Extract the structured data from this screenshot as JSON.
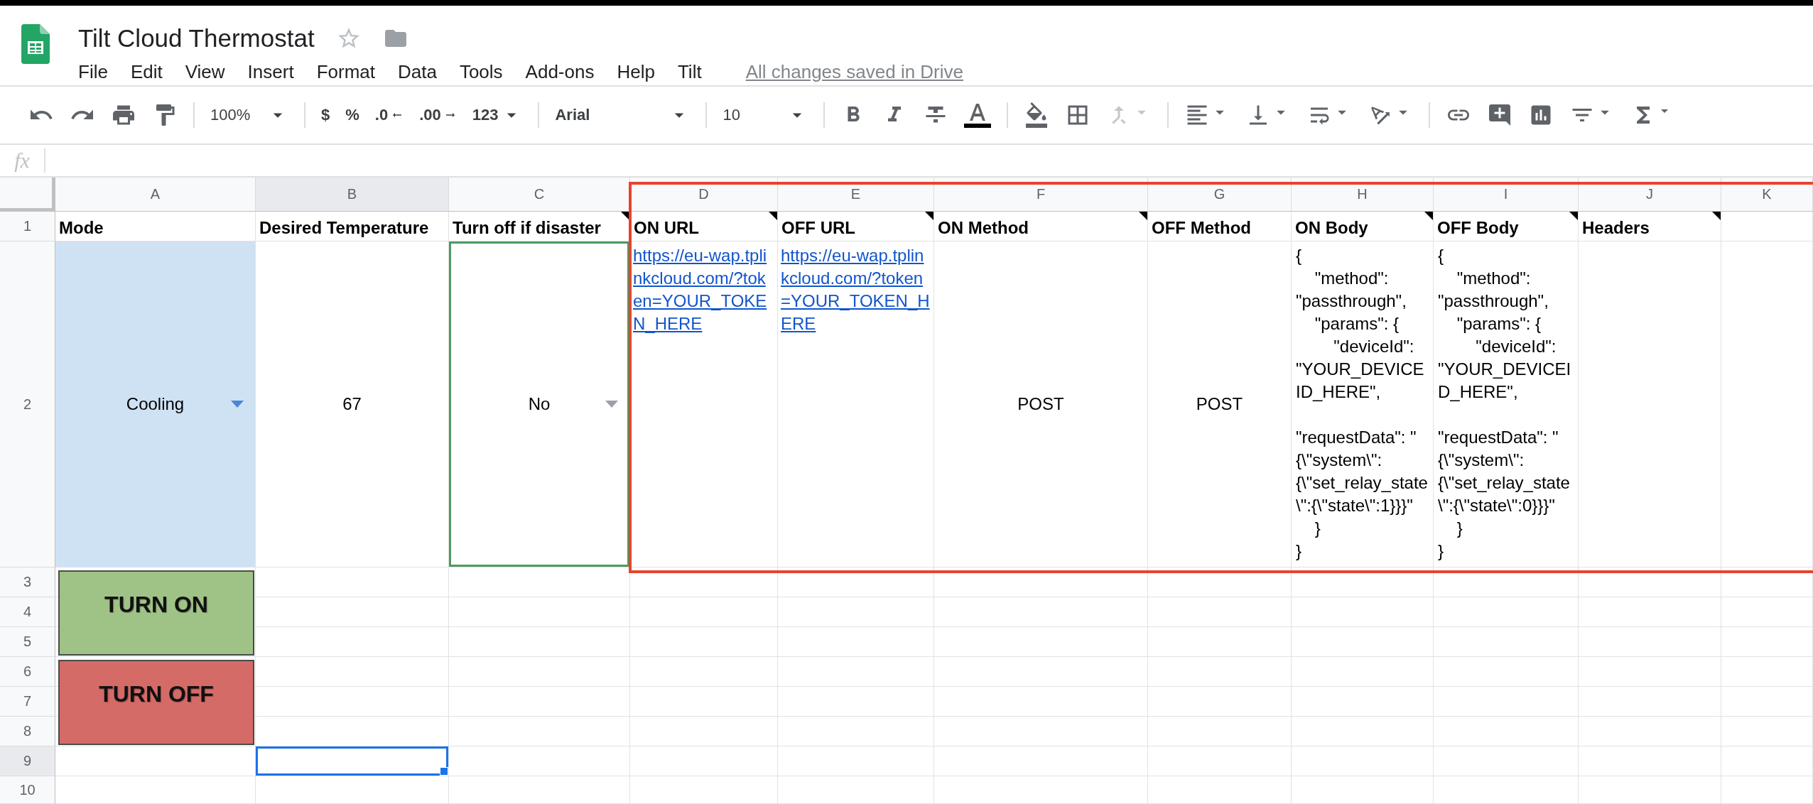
{
  "document": {
    "title": "Tilt Cloud Thermostat",
    "starred": false,
    "save_status": "All changes saved in Drive"
  },
  "menu": [
    "File",
    "Edit",
    "View",
    "Insert",
    "Format",
    "Data",
    "Tools",
    "Add-ons",
    "Help",
    "Tilt"
  ],
  "toolbar": {
    "zoom": "100%",
    "currency": "$",
    "percent": "%",
    "decrease_decimals": ".0",
    "increase_decimals": ".00",
    "more_formats": "123",
    "font": "Arial",
    "font_size": "10",
    "merge_disabled": true
  },
  "formula_bar": {
    "label": "fx"
  },
  "columns": [
    {
      "label": "A",
      "selected": false
    },
    {
      "label": "B",
      "selected": true
    },
    {
      "label": "C",
      "selected": false
    },
    {
      "label": "D",
      "selected": false
    },
    {
      "label": "E",
      "selected": false
    },
    {
      "label": "F",
      "selected": false
    },
    {
      "label": "G",
      "selected": false
    },
    {
      "label": "H",
      "selected": false
    },
    {
      "label": "I",
      "selected": false
    },
    {
      "label": "J",
      "selected": false
    },
    {
      "label": "K",
      "selected": false
    }
  ],
  "rows": [
    {
      "number": "1",
      "selected": false,
      "cells": [
        {
          "kind": "header",
          "text": "Mode",
          "has_note": false
        },
        {
          "kind": "header",
          "text": "Desired Temperature",
          "has_note": false
        },
        {
          "kind": "header",
          "text": "Turn off if disaster",
          "has_note": true
        },
        {
          "kind": "header",
          "text": "ON URL",
          "has_note": true
        },
        {
          "kind": "header",
          "text": "OFF URL",
          "has_note": true
        },
        {
          "kind": "header",
          "text": "ON Method",
          "has_note": true
        },
        {
          "kind": "header",
          "text": "OFF Method",
          "has_note": false
        },
        {
          "kind": "header",
          "text": "ON Body",
          "has_note": true
        },
        {
          "kind": "header",
          "text": "OFF Body",
          "has_note": true
        },
        {
          "kind": "header",
          "text": "Headers",
          "has_note": true
        }
      ]
    },
    {
      "number": "2",
      "selected": false,
      "cells": [
        {
          "kind": "dropdown",
          "text": "Cooling",
          "color": "#cfe2f3",
          "outlined": false
        },
        {
          "kind": "number",
          "text": "67",
          "outlined": false
        },
        {
          "kind": "dropdown",
          "text": "No",
          "outlined": true
        },
        {
          "kind": "link",
          "text": "https://eu-wap.tplinkcloud.com/?token=YOUR_TOKEN_HERE",
          "outlined": false
        },
        {
          "kind": "link",
          "text": "https://eu-wap.tplinkcloud.com/?token=YOUR_TOKEN_HERE",
          "outlined": false
        },
        {
          "kind": "text",
          "text": "POST",
          "outlined": false
        },
        {
          "kind": "text",
          "text": "POST",
          "outlined": false
        },
        {
          "kind": "code",
          "text": "{\n    \"method\": \"passthrough\",\n    \"params\": {\n        \"deviceId\": \"YOUR_DEVICEID_HERE\",\n\n\"requestData\": \"{\\\"system\\\":{\\\"set_relay_state\\\":{\\\"state\\\":1}}}\"\n    }\n}",
          "outlined": false
        },
        {
          "kind": "code",
          "text": "{\n    \"method\": \"passthrough\",\n    \"params\": {\n        \"deviceId\": \"YOUR_DEVICEID_HERE\",\n\n\"requestData\": \"{\\\"system\\\":{\\\"set_relay_state\\\":{\\\"state\\\":0}}}\"\n    }\n}",
          "outlined": false
        },
        {
          "kind": "empty",
          "outlined": false
        }
      ]
    },
    {
      "number": "3",
      "selected": false
    },
    {
      "number": "4",
      "selected": false
    },
    {
      "number": "5",
      "selected": false
    },
    {
      "number": "6",
      "selected": false
    },
    {
      "number": "7",
      "selected": false
    },
    {
      "number": "8",
      "selected": false
    },
    {
      "number": "9",
      "selected": true
    },
    {
      "number": "10",
      "selected": false
    }
  ],
  "drawings": [
    {
      "label": "TURN ON",
      "color": "#9fc386"
    },
    {
      "label": "TURN OFF",
      "color": "#d46b67"
    }
  ]
}
